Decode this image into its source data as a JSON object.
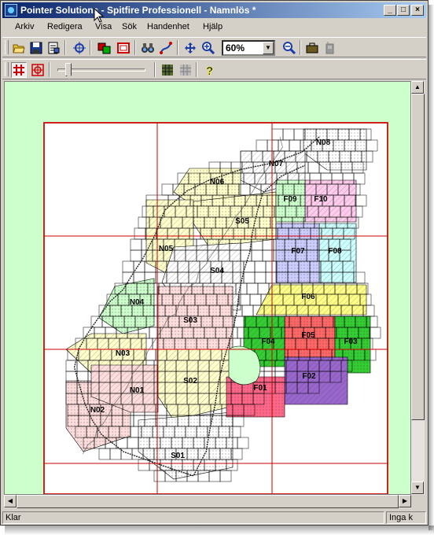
{
  "window": {
    "title": "Pointer Solutions - Spitfire Professionell - Namnlös *",
    "controls": {
      "minimize": "_",
      "maximize": "□",
      "close": "×"
    }
  },
  "menu": {
    "items": [
      "Arkiv",
      "Redigera",
      "Visa",
      "Sök",
      "Handenhet",
      "Hjälp"
    ]
  },
  "toolbar": {
    "zoom_value": "60%",
    "icons": [
      "open-folder-icon",
      "save-disk-icon",
      "properties-icon",
      "crosshair-target-icon",
      "layers-icon",
      "window-frame-icon",
      "binoculars-icon",
      "route-curve-icon",
      "move-arrows-icon",
      "zoom-in-icon",
      "zoom-out-icon",
      "briefcase-icon",
      "gps-device-icon"
    ]
  },
  "toolbar2": {
    "icons": [
      "grid-icon",
      "target-grid-icon",
      "slider-thumb",
      "tile-grid-icon",
      "tile-grid-disabled-icon",
      "help-icon"
    ],
    "slider_level": 0.08
  },
  "map": {
    "background": "#ccffcc",
    "frame_color": "#cc0000",
    "regions": [
      {
        "label": "N08",
        "color": "#ffffff"
      },
      {
        "label": "N07",
        "color": "#ffffff"
      },
      {
        "label": "N06",
        "color": "#ffffcc"
      },
      {
        "label": "N05",
        "color": "#ffffcc"
      },
      {
        "label": "N04",
        "color": "#ccffcc"
      },
      {
        "label": "N03",
        "color": "#ffffcc"
      },
      {
        "label": "N02",
        "color": "#ffdddd"
      },
      {
        "label": "N01",
        "color": "#ffdddd"
      },
      {
        "label": "S05",
        "color": "#ffffcc"
      },
      {
        "label": "S04",
        "color": "#ffffff"
      },
      {
        "label": "S03",
        "color": "#ffdddd"
      },
      {
        "label": "S02",
        "color": "#ffffcc"
      },
      {
        "label": "S01",
        "color": "#ffffff"
      },
      {
        "label": "F10",
        "color": "#ffccee"
      },
      {
        "label": "F09",
        "color": "#ccffcc"
      },
      {
        "label": "F08",
        "color": "#ccffff"
      },
      {
        "label": "F07",
        "color": "#ccccff"
      },
      {
        "label": "F06",
        "color": "#ffff88"
      },
      {
        "label": "F05",
        "color": "#ff6666"
      },
      {
        "label": "F04",
        "color": "#33cc33"
      },
      {
        "label": "F03",
        "color": "#33cc33"
      },
      {
        "label": "F02",
        "color": "#9966cc"
      },
      {
        "label": "F01",
        "color": "#ff6688"
      }
    ]
  },
  "statusbar": {
    "left": "Klar",
    "right": "Inga k"
  }
}
